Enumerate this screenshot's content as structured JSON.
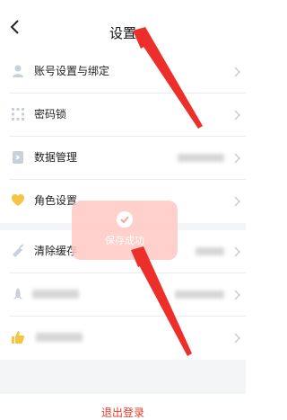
{
  "header": {
    "title": "设置"
  },
  "menu": {
    "account": "账号设置与绑定",
    "password": "密码锁",
    "data": "数据管理",
    "role": "角色设置",
    "cache": "清除缓存"
  },
  "toast": {
    "message": "保存成功"
  },
  "footer": {
    "logout": "退出登录"
  },
  "colors": {
    "accent": "#e23b2c",
    "toast_bg": "#ffc8c3",
    "role_icon": "#f5c542",
    "thumb_icon": "#f5c542"
  }
}
